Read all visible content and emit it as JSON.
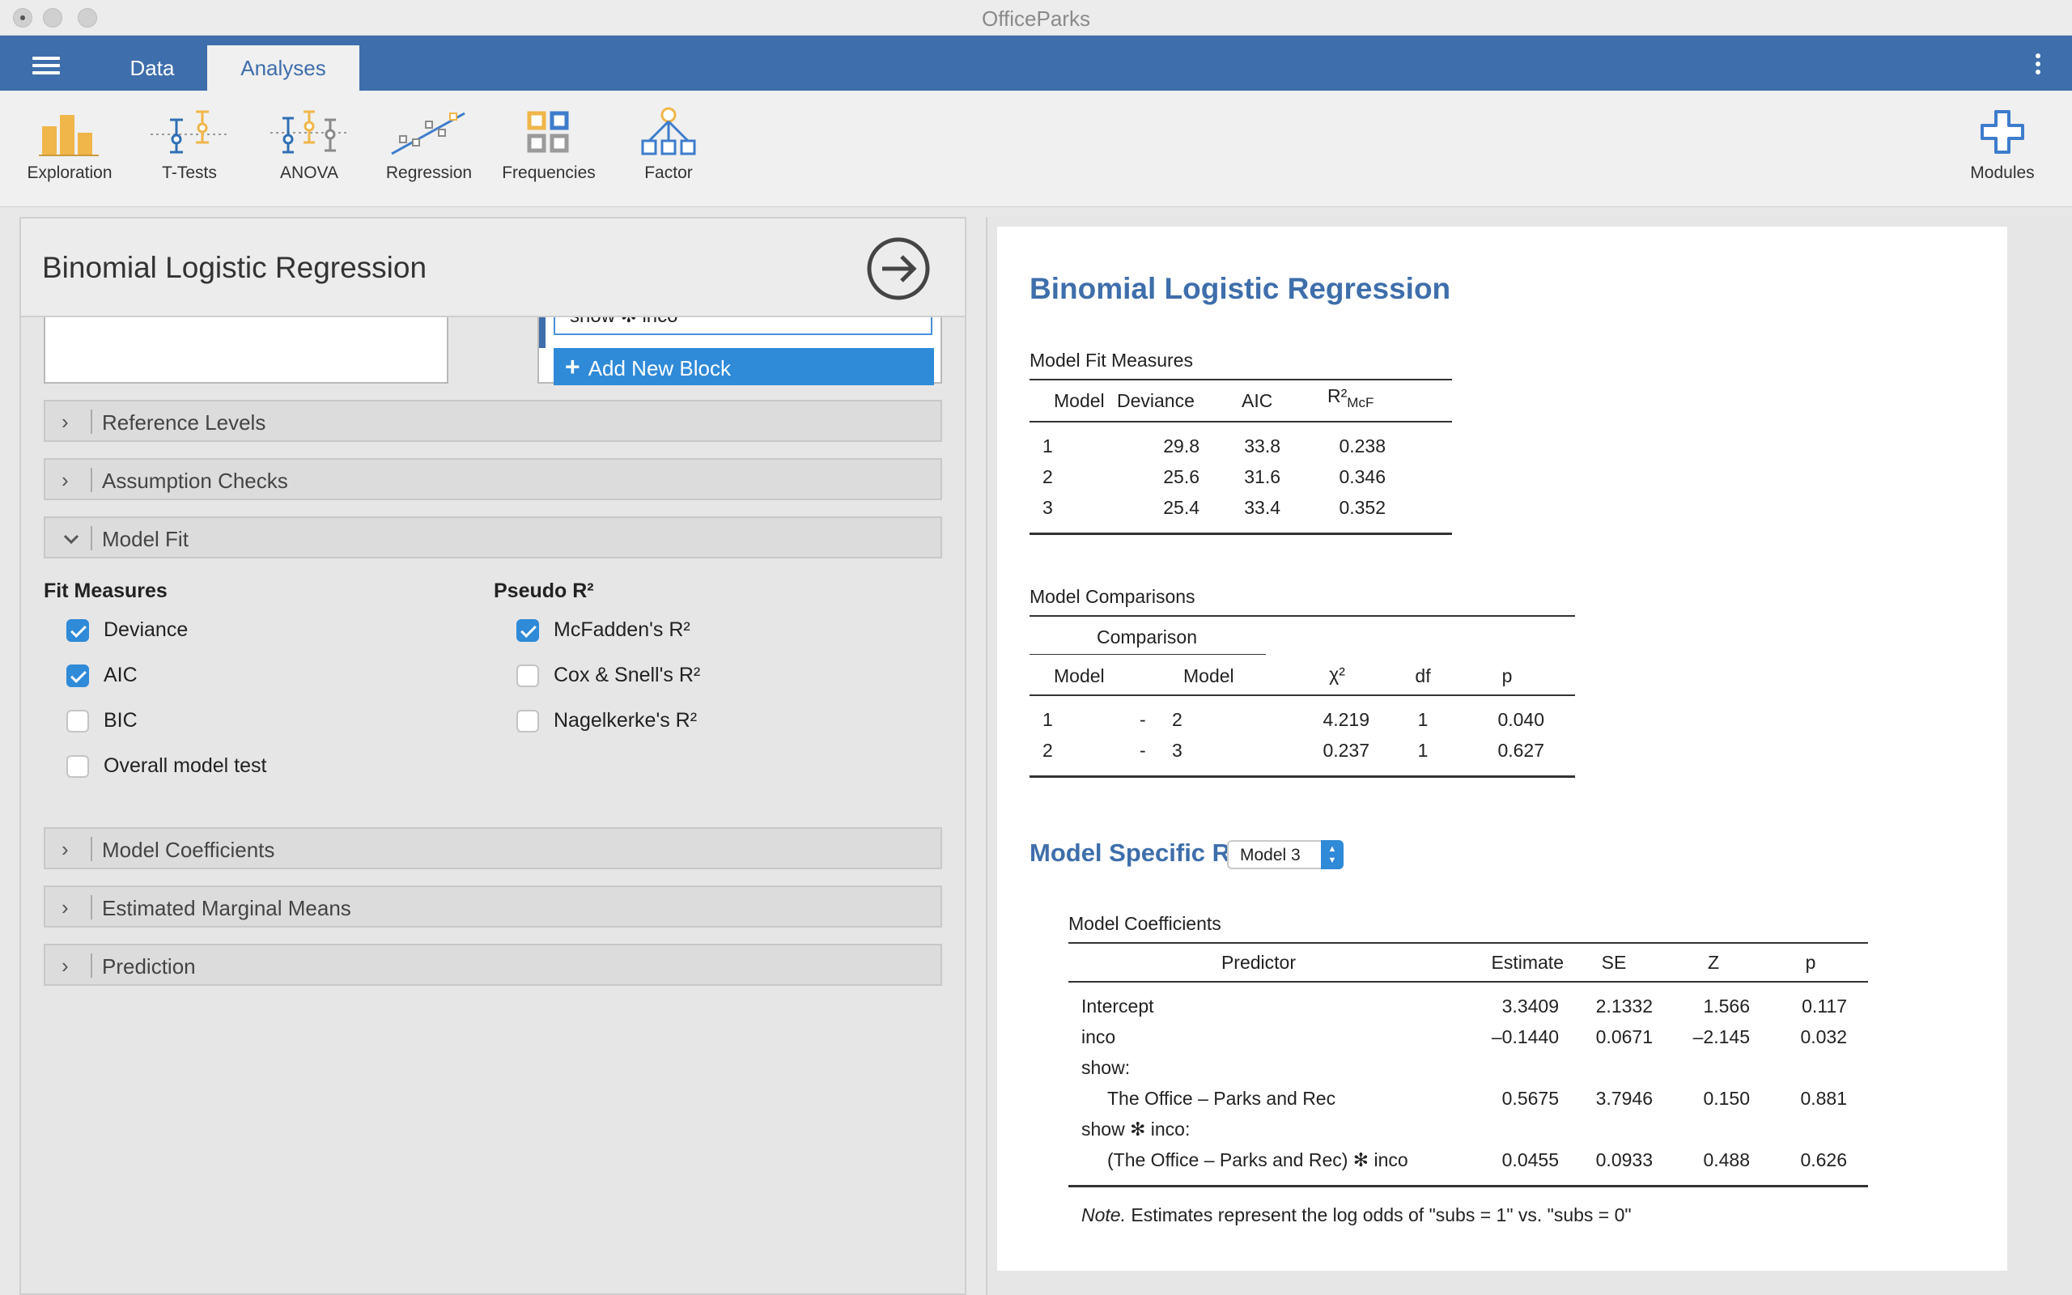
{
  "window": {
    "title": "OfficeParks"
  },
  "topbar": {
    "tabs": [
      "Data",
      "Analyses"
    ]
  },
  "ribbon": {
    "items": [
      "Exploration",
      "T-Tests",
      "ANOVA",
      "Regression",
      "Frequencies",
      "Factor"
    ],
    "modules_label": "Modules"
  },
  "left": {
    "title": "Binomial Logistic Regression",
    "block_term": "show ✻ inco",
    "add_block": "Add New Block",
    "sections_top": [
      "Reference Levels",
      "Assumption Checks",
      "Model Fit"
    ],
    "fit_measures": {
      "heading": "Fit Measures",
      "options": [
        {
          "label": "Deviance",
          "checked": true
        },
        {
          "label": "AIC",
          "checked": true
        },
        {
          "label": "BIC",
          "checked": false
        },
        {
          "label": "Overall model test",
          "checked": false
        }
      ]
    },
    "pseudo_r2": {
      "heading": "Pseudo R²",
      "options": [
        {
          "label": "McFadden's R²",
          "checked": true
        },
        {
          "label": "Cox & Snell's R²",
          "checked": false
        },
        {
          "label": "Nagelkerke's R²",
          "checked": false
        }
      ]
    },
    "sections_bottom": [
      "Model Coefficients",
      "Estimated Marginal Means",
      "Prediction"
    ]
  },
  "results": {
    "title": "Binomial Logistic Regression",
    "model_fit": {
      "caption": "Model Fit Measures",
      "headers": [
        "Model",
        "Deviance",
        "AIC",
        "R²",
        "McF"
      ],
      "rows": [
        [
          "1",
          "29.8",
          "33.8",
          "0.238"
        ],
        [
          "2",
          "25.6",
          "31.6",
          "0.346"
        ],
        [
          "3",
          "25.4",
          "33.4",
          "0.352"
        ]
      ]
    },
    "model_comparisons": {
      "caption": "Model Comparisons",
      "group_header": "Comparison",
      "headers": [
        "Model",
        "Model",
        "χ²",
        "df",
        "p"
      ],
      "rows": [
        [
          "1",
          "-",
          "2",
          "4.219",
          "1",
          "0.040"
        ],
        [
          "2",
          "-",
          "3",
          "0.237",
          "1",
          "0.627"
        ]
      ]
    },
    "model_specific": {
      "title": "Model Specific Results",
      "selected_model": "Model 3",
      "coefficients": {
        "caption": "Model Coefficients",
        "headers": [
          "Predictor",
          "Estimate",
          "SE",
          "Z",
          "p"
        ],
        "rows": [
          [
            "Intercept",
            "3.3409",
            "2.1332",
            "1.566",
            "0.117"
          ],
          [
            "inco",
            "–0.1440",
            "0.0671",
            "–2.145",
            "0.032"
          ],
          [
            "show:",
            "",
            "",
            "",
            ""
          ],
          [
            "The Office – Parks and Rec",
            "0.5675",
            "3.7946",
            "0.150",
            "0.881"
          ],
          [
            "show ✻ inco:",
            "",
            "",
            "",
            ""
          ],
          [
            "(The Office – Parks and Rec) ✻ inco",
            "0.0455",
            "0.0933",
            "0.488",
            "0.626"
          ]
        ],
        "note_label": "Note.",
        "note_text": "Estimates represent the log odds of \"subs = 1\" vs. \"subs = 0\""
      }
    }
  },
  "colors": {
    "accent": "#3e6eab",
    "checkbox": "#2f8ad8",
    "exploration": "#f0b64a"
  }
}
